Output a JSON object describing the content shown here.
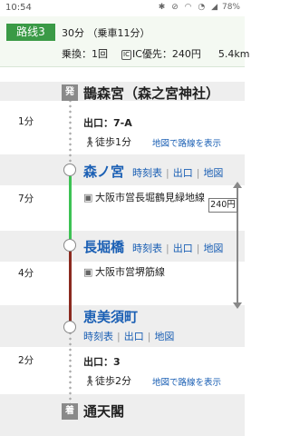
{
  "status_bar": {
    "time": "10:54",
    "icons": [
      "bluetooth-icon",
      "mute-icon",
      "wifi-icon",
      "alarm-icon",
      "signal-icon"
    ],
    "battery": "78%"
  },
  "route": {
    "tag": "路线3",
    "time": "30分 （乗車11分）",
    "transfers": "乗換：1回",
    "ic_icon": "IC",
    "fare": "IC優先：240円",
    "distance": "5.4km"
  },
  "colors": {
    "accent_green": "#3a9a46",
    "line_sakaisuji_green": "#3dc254",
    "line_nagahori_red": "#8b2a1f",
    "link_blue": "#1a5fb4"
  },
  "markers": {
    "start": "発",
    "end": "着"
  },
  "stations": {
    "origin": {
      "name": "鵲森宮（森之宮神社）"
    },
    "morinomiya": {
      "name": "森ノ宮"
    },
    "nagahoribashi": {
      "name": "長堀橋"
    },
    "ebisucho": {
      "name": "恵美須町"
    },
    "destination": {
      "name": "通天閣"
    }
  },
  "station_links": {
    "timetable": "時刻表",
    "exit": "出口",
    "map": "地図",
    "sep": "|"
  },
  "segments": {
    "walk1": {
      "duration": "1分",
      "exit": "出口：7-A",
      "walk": "徒歩1分",
      "map_link": "地図で路線を表示"
    },
    "train1": {
      "duration": "7分",
      "line": "大阪市営長堀鶴見緑地線"
    },
    "train2": {
      "duration": "4分",
      "line": "大阪市営堺筋線"
    },
    "walk2": {
      "duration": "2分",
      "exit": "出口：3",
      "walk": "徒歩2分",
      "map_link": "地図で路線を表示"
    }
  },
  "fare_bracket": "240円"
}
